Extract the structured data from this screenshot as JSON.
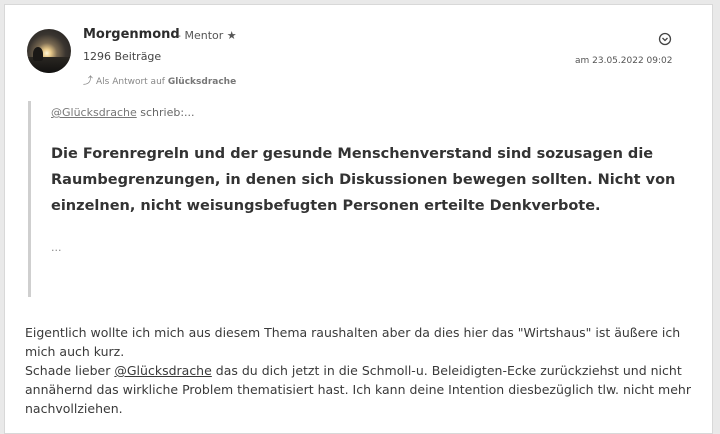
{
  "post": {
    "author": {
      "name": "Morgenmond",
      "role": "- Mentor ★",
      "post_count": "1296 Beiträge"
    },
    "reply": {
      "prefix": "Als Antwort auf",
      "target": "Glücksdrache"
    },
    "date": "am 23.05.2022 09:02",
    "quote": {
      "author_mention": "@Glücksdrache",
      "author_suffix": "schrieb:...",
      "text": "Die Forenregreln und der gesunde Menschenverstand sind sozusagen die Raumbegrenzungen, in denen sich Diskussionen bewegen sollten. Nicht von einzelnen, nicht weisungsbefugten Personen erteilte Denkverbote.",
      "ellipsis": "..."
    },
    "body": {
      "paragraph1": "Eigentlich wollte ich mich aus diesem Thema raushalten aber da dies hier das \"Wirtshaus\" ist äußere ich mich auch kurz.",
      "paragraph2_before": "Schade lieber ",
      "paragraph2_mention": "@Glücksdrache",
      "paragraph2_after": " das du dich jetzt in die Schmoll-u. Beleidigten-Ecke zurückziehst und nicht annähernd das wirkliche Problem thematisiert hast. Ich kann deine Intention diesbezüglich tlw. nicht mehr nachvollziehen."
    }
  },
  "icons": {
    "menu": "chevron-circle-down-icon",
    "reply": "reply-arrow-icon"
  }
}
